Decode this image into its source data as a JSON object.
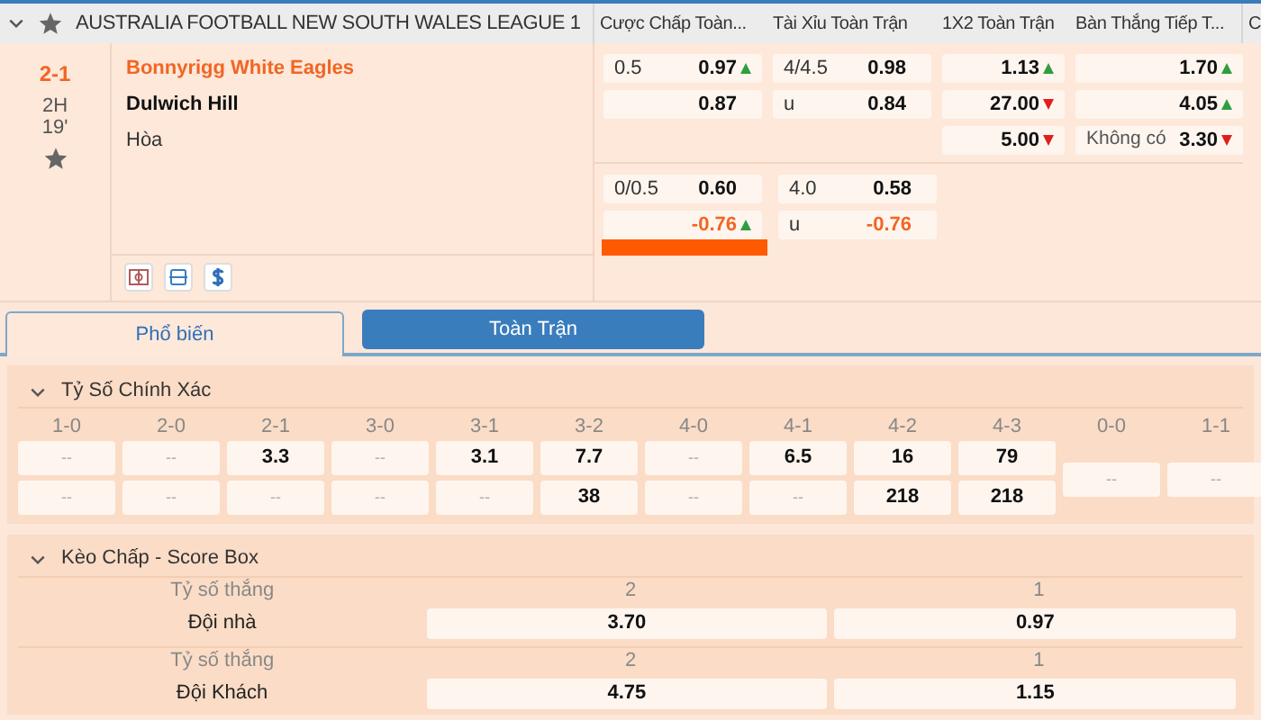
{
  "league": {
    "title": "AUSTRALIA FOOTBALL NEW SOUTH WALES LEAGUE 1",
    "expanded": true,
    "columns": [
      "Cược Chấp Toàn...",
      "Tài Xỉu Toàn Trận",
      "1X2 Toàn Trận",
      "Bàn Thắng Tiếp T...",
      "C"
    ]
  },
  "match": {
    "score": "2-1",
    "period": "2H",
    "minute": "19'",
    "home": "Bonnyrigg White Eagles",
    "away": "Dulwich Hill",
    "draw": "Hòa"
  },
  "lines": [
    {
      "handicap": [
        {
          "line": "0.5",
          "odds": "0.97",
          "rising": true,
          "negative": false
        },
        {
          "odds": "0.87",
          "negative": false
        }
      ],
      "over_under": [
        {
          "line": "4/4.5",
          "odds": "0.98",
          "negative": false
        },
        {
          "line": "u",
          "odds": "0.84",
          "negative": false
        }
      ],
      "x12": [
        {
          "odds": "1.13",
          "rising": true
        },
        {
          "odds": "27.00",
          "rising": false
        },
        {
          "odds": "5.00",
          "rising": false
        }
      ],
      "next_goal": [
        {
          "odds": "1.70",
          "rising": true
        },
        {
          "odds": "4.05",
          "rising": true
        },
        {
          "label": "Không có",
          "odds": "3.30",
          "rising": false
        }
      ]
    },
    {
      "handicap": [
        {
          "line": "0/0.5",
          "odds": "0.60",
          "negative": false
        },
        {
          "odds": "-0.76",
          "rising": true,
          "negative": true
        }
      ],
      "over_under": [
        {
          "line": "4.0",
          "odds": "0.58",
          "negative": false
        },
        {
          "line": "u",
          "odds": "-0.76",
          "negative": true
        }
      ]
    }
  ],
  "tabs": [
    {
      "label": "Phổ biến",
      "selected": true
    },
    {
      "label": "Toàn Trận",
      "selected": false
    }
  ],
  "correct_score": {
    "title": "Tỷ Số Chính Xác",
    "expanded": true,
    "columns": [
      {
        "kind": "pair",
        "score": "1-0",
        "home": "--",
        "away": "--"
      },
      {
        "kind": "pair",
        "score": "2-0",
        "home": "--",
        "away": "--"
      },
      {
        "kind": "pair",
        "score": "2-1",
        "home": "3.3",
        "away": "--"
      },
      {
        "kind": "pair",
        "score": "3-0",
        "home": "--",
        "away": "--"
      },
      {
        "kind": "pair",
        "score": "3-1",
        "home": "3.1",
        "away": "--"
      },
      {
        "kind": "pair",
        "score": "3-2",
        "home": "7.7",
        "away": "38"
      },
      {
        "kind": "pair",
        "score": "4-0",
        "home": "--",
        "away": "--"
      },
      {
        "kind": "pair",
        "score": "4-1",
        "home": "6.5",
        "away": "--"
      },
      {
        "kind": "pair",
        "score": "4-2",
        "home": "16",
        "away": "218"
      },
      {
        "kind": "pair",
        "score": "4-3",
        "home": "79",
        "away": "218"
      },
      {
        "kind": "single",
        "score": "0-0",
        "draw": "--"
      },
      {
        "kind": "single",
        "score": "1-1",
        "draw": "--"
      }
    ]
  },
  "score_box": {
    "title": "Kèo Chấp - Score Box",
    "expanded": true,
    "rows": [
      {
        "caption": "Tỷ số thắng",
        "team": "Đội nhà",
        "cells": [
          {
            "goals": "2",
            "odds": "3.70"
          },
          {
            "goals": "1",
            "odds": "0.97"
          }
        ]
      },
      {
        "caption": "Tỷ số thắng",
        "team": "Đội Khách",
        "cells": [
          {
            "goals": "2",
            "odds": "4.75"
          },
          {
            "goals": "1",
            "odds": "1.15"
          }
        ]
      }
    ]
  }
}
